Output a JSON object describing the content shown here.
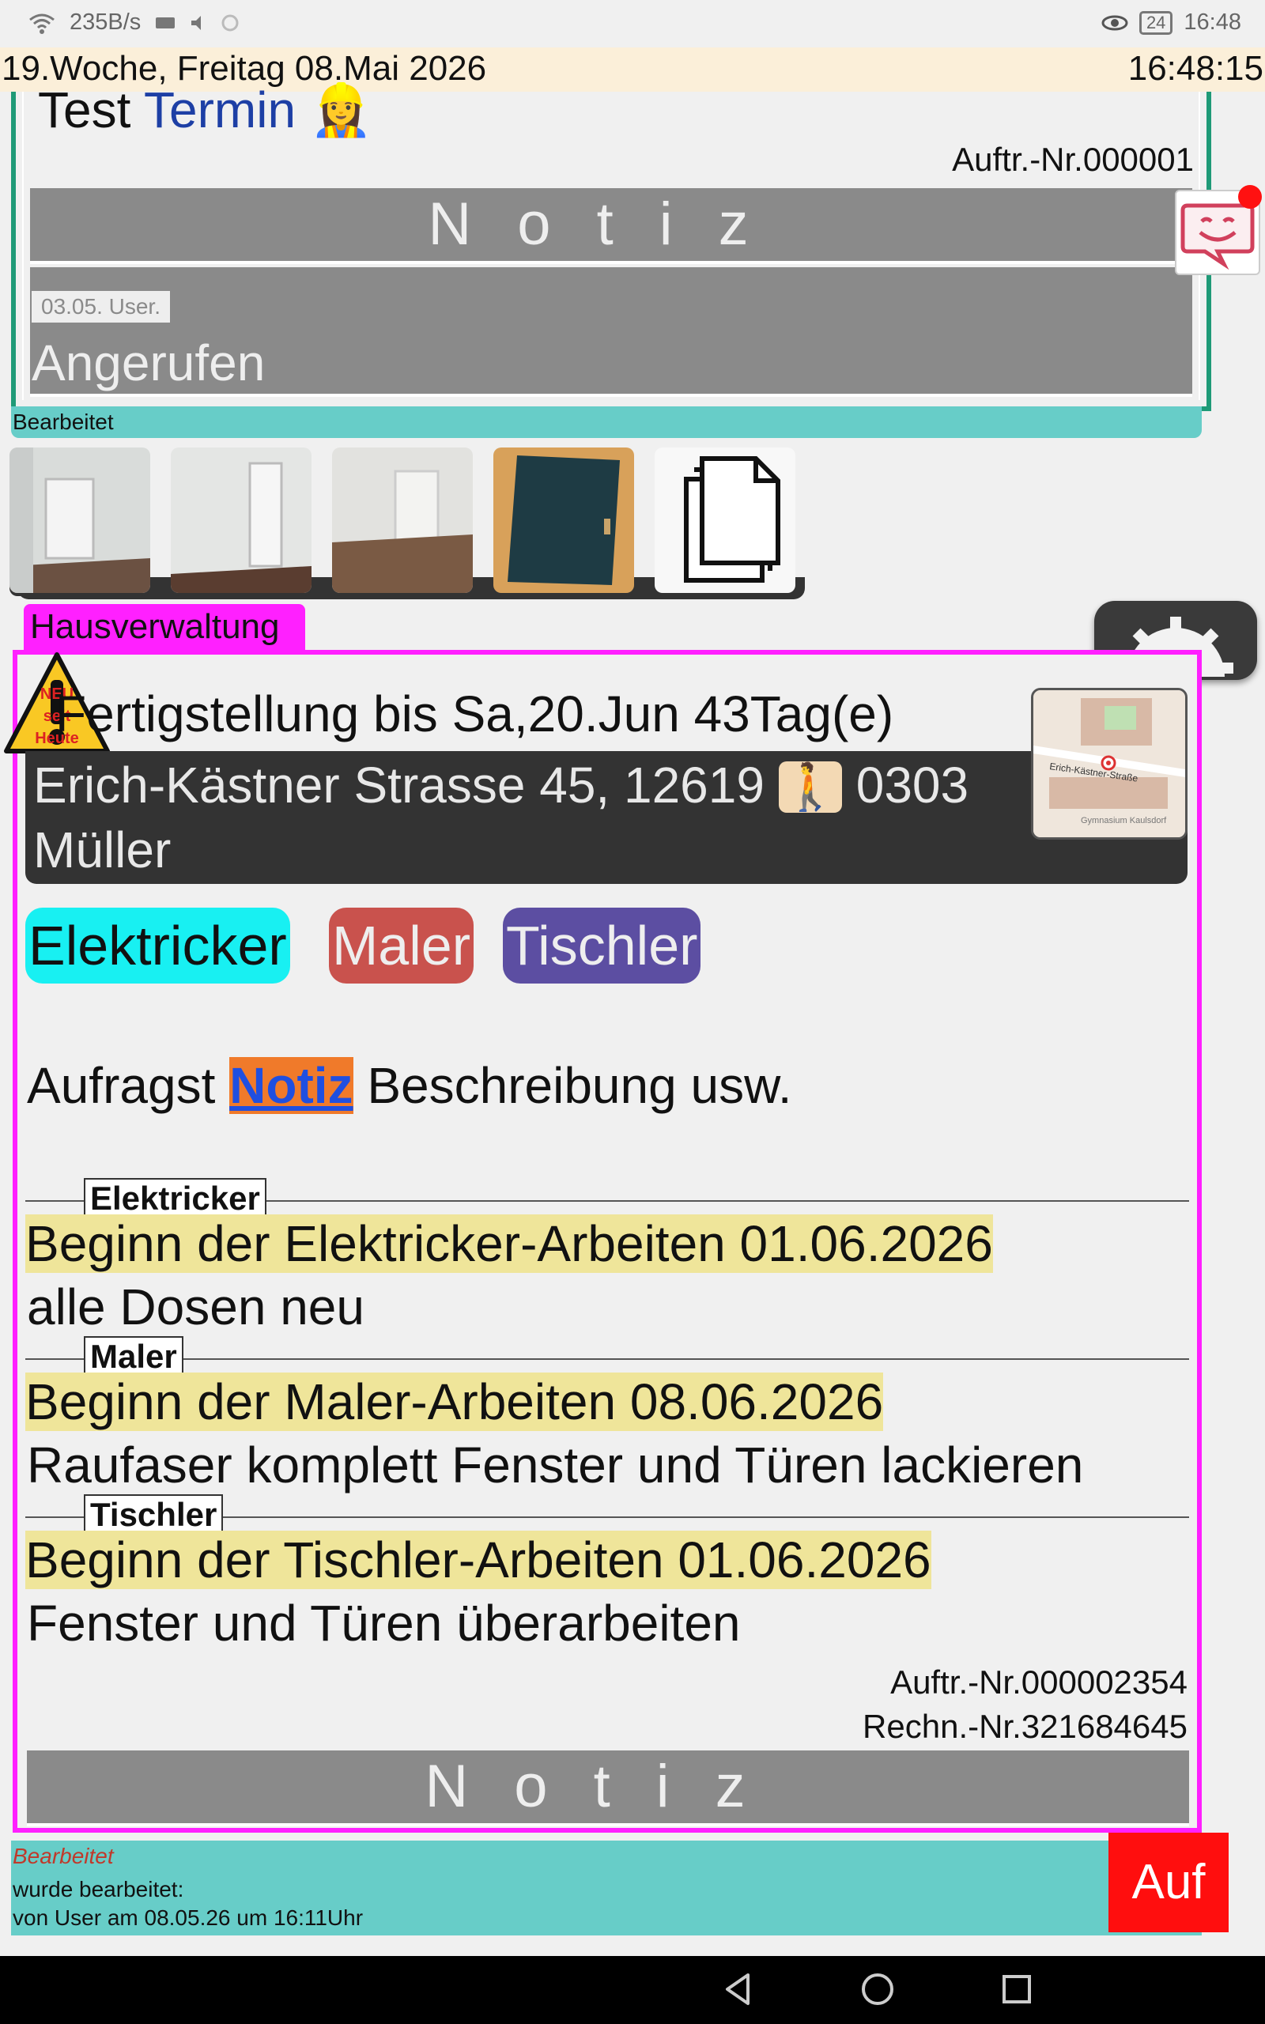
{
  "status_bar": {
    "network_speed": "235B/s",
    "time": "16:48",
    "battery": "24"
  },
  "date_bar": {
    "date": "19.Woche, Freitag 08.Mai 2026",
    "clock": "16:48:15"
  },
  "card1": {
    "title_word1": "Test",
    "title_word2": "Termin",
    "title_emoji": "👷‍♀️",
    "auftr_nr": "Auftr.-Nr.000001",
    "notiz_label": "Notiz",
    "note_date": "03.05. User.",
    "note_text": "Angerufen",
    "edited": "Bearbeitet"
  },
  "thumbnails": [
    "room-window-photo",
    "room-door-photo",
    "room-floor-photo",
    "blue-door-photo",
    "documents-icon"
  ],
  "main_card": {
    "category": "Hausverwaltung",
    "warning_badge": [
      "NEU",
      "seit",
      "Heute"
    ],
    "deadline": "Fertigstellung bis Sa,20.Jun 43Tag(e)",
    "address_line1": "Erich-Kästner Strasse 45, 12619",
    "stairs_emoji": "🚶",
    "apartment": "0303",
    "tenant": "Müller",
    "map_labels": [
      "Erich-Kästner-Straße",
      "Gymnasium Kaulsdorf"
    ],
    "tags": [
      {
        "label": "Elektricker",
        "color": "#18f0f2",
        "text_color": "#111111"
      },
      {
        "label": "Maler",
        "color": "#c9524d",
        "text_color": "#eeeeee"
      },
      {
        "label": "Tischler",
        "color": "#5c4ea2",
        "text_color": "#eeeeee"
      }
    ],
    "request_prefix": "Aufragst",
    "request_link": "Notiz",
    "request_suffix": "Beschreibung usw.",
    "sections": [
      {
        "label": "Elektricker",
        "begin": "Beginn der Elektricker-Arbeiten 01.06.2026",
        "desc": "alle Dosen neu"
      },
      {
        "label": "Maler",
        "begin": "Beginn der Maler-Arbeiten 08.06.2026",
        "desc": "Raufaser komplett Fenster und Türen lackieren"
      },
      {
        "label": "Tischler",
        "begin": "Beginn der Tischler-Arbeiten 01.06.2026",
        "desc": "Fenster und Türen überarbeiten"
      }
    ],
    "auftr_nr": "Auftr.-Nr.000002354",
    "rechn_nr": "Rechn.-Nr.321684645",
    "notiz_label": "Notiz"
  },
  "footer": {
    "edited": "Bearbeitet",
    "edited_line1": "wurde bearbeitet:",
    "edited_line2": "von User am 08.05.26 um 16:11Uhr",
    "auf_button": "Auf"
  }
}
